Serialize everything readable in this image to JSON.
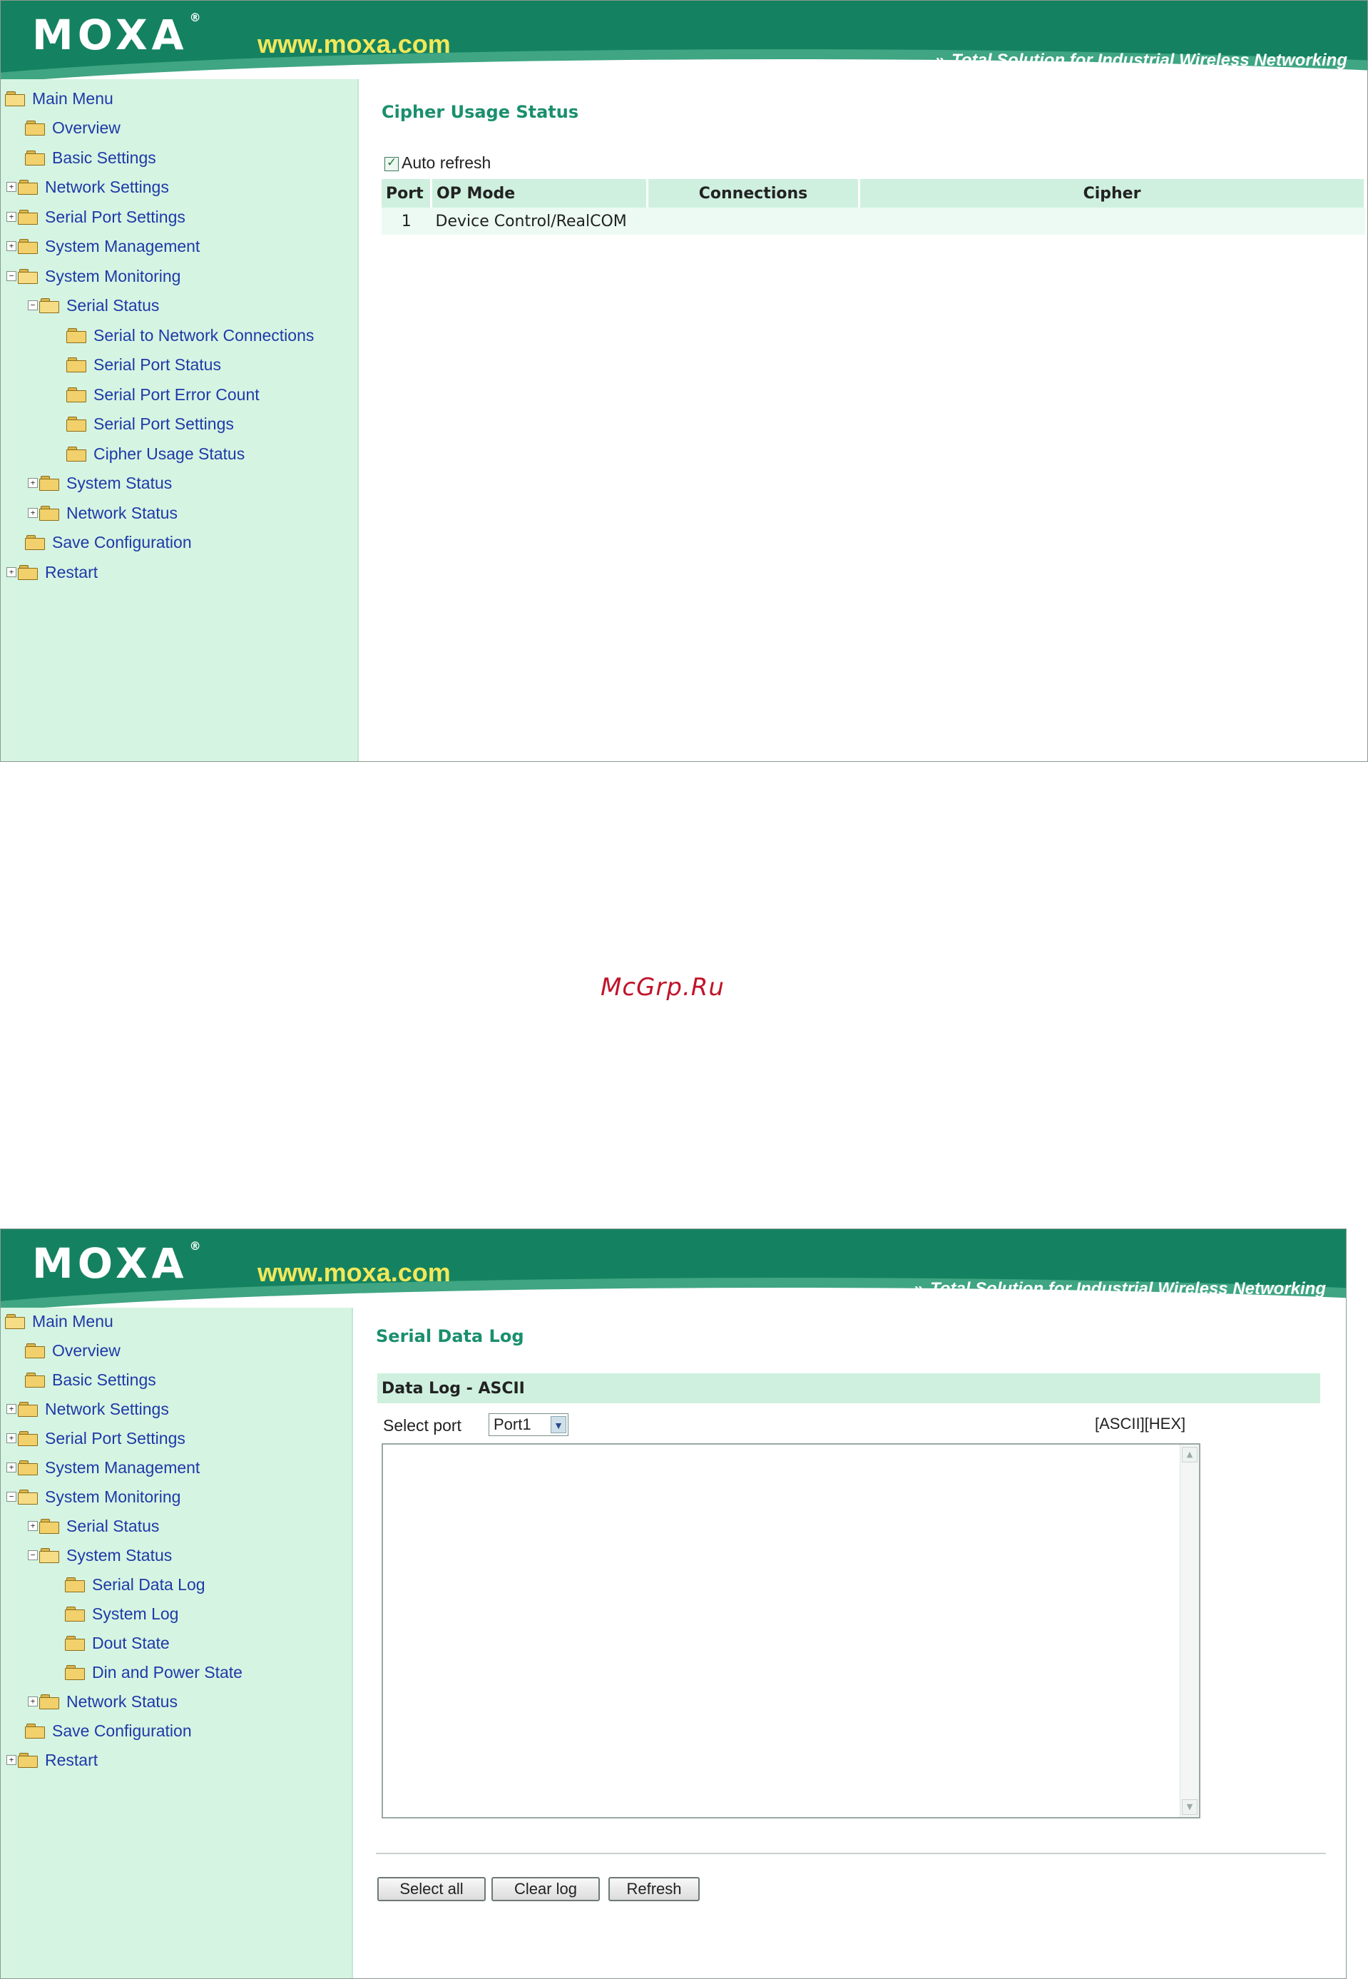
{
  "brand": {
    "logo_text": "MOXA",
    "logo_mark": "®",
    "url": "www.moxa.com",
    "tagline": "Total Solution for Industrial Wireless Networking",
    "colors": {
      "header": "#148260",
      "sidebar": "#d6f4e2",
      "title": "#1a8f6d",
      "url": "#f2e85a",
      "link": "#1e3aa8"
    }
  },
  "screen1": {
    "menu": [
      "Main Menu",
      "Overview",
      "Basic Settings",
      "Network Settings",
      "Serial Port Settings",
      "System Management",
      "System Monitoring",
      "Serial Status",
      "Serial to Network Connections",
      "Serial Port Status",
      "Serial Port Error Count",
      "Serial Port Settings",
      "Cipher Usage Status",
      "System Status",
      "Network Status",
      "Save Configuration",
      "Restart"
    ],
    "title": "Cipher Usage Status",
    "auto_refresh_label": "Auto refresh",
    "table": {
      "headers": [
        "Port",
        "OP Mode",
        "Connections",
        "Cipher"
      ],
      "rows": [
        [
          "1",
          "Device Control/RealCOM",
          "",
          ""
        ]
      ]
    }
  },
  "watermark": "McGrp.Ru",
  "screen2": {
    "menu": [
      "Main Menu",
      "Overview",
      "Basic Settings",
      "Network Settings",
      "Serial Port Settings",
      "System Management",
      "System Monitoring",
      "Serial Status",
      "System Status",
      "Serial Data Log",
      "System Log",
      "Dout State",
      "Din and Power State",
      "Network Status",
      "Save Configuration",
      "Restart"
    ],
    "title": "Serial Data Log",
    "section": "Data Log - ASCII",
    "select_port_label": "Select port",
    "port_value": "Port1",
    "view_links": "[ASCII][HEX]",
    "buttons": {
      "select_all": "Select all",
      "clear_log": "Clear log",
      "refresh": "Refresh"
    }
  }
}
